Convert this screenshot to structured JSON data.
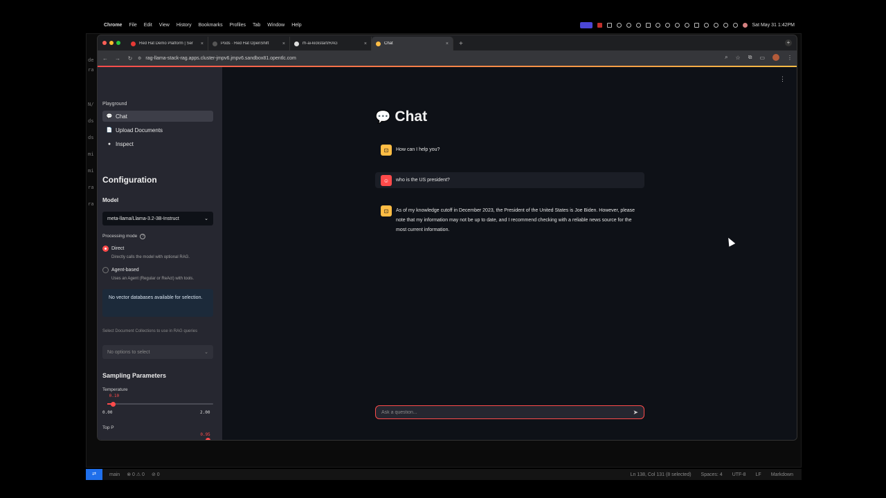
{
  "menubar": {
    "items": [
      "Chrome",
      "File",
      "Edit",
      "View",
      "History",
      "Bookmarks",
      "Profiles",
      "Tab",
      "Window",
      "Help"
    ],
    "clock": "Sat May 31  1:42PM"
  },
  "browser": {
    "tabs": [
      {
        "title": "Red Hat Demo Platform | Ser",
        "color": "#e53935"
      },
      {
        "title": "Pods · Red Hat OpenShift",
        "color": "#555555"
      },
      {
        "title": "rh-ai-kickstart/RAG",
        "color": "#dddddd"
      },
      {
        "title": "Chat",
        "color": "#ffbd45"
      }
    ],
    "url": "rag-llama-stack-rag.apps.cluster-jmpv6.jmpv6.sandbox81.opentlc.com"
  },
  "sidebar": {
    "section_label": "Playground",
    "nav": [
      {
        "label": "Chat",
        "icon": "💬"
      },
      {
        "label": "Upload Documents",
        "icon": "📄"
      },
      {
        "label": "Inspect",
        "icon": "●"
      }
    ],
    "config_title": "Configuration",
    "model_label": "Model",
    "model_value": "meta-llama/Llama-3.2-3B-Instruct",
    "processing_label": "Processing mode",
    "modes": [
      {
        "label": "Direct",
        "desc": "Directly calls the model with optional RAG.",
        "selected": true
      },
      {
        "label": "Agent-based",
        "desc": "Uses an Agent (Regular or ReAct) with tools.",
        "selected": false
      }
    ],
    "info": "No vector databases available for selection.",
    "collections_label": "Select Document Collections to use in RAG queries",
    "collections_placeholder": "No options to select",
    "sampling_title": "Sampling Parameters",
    "temperature": {
      "label": "Temperature",
      "value": 0.1,
      "value_text": "0.10",
      "min": "0.00",
      "max": "2.00"
    },
    "top_p": {
      "label": "Top P",
      "value": 0.95,
      "value_text": "0.95"
    }
  },
  "main": {
    "title": "Chat",
    "messages": [
      {
        "role": "assistant",
        "text": "How can I help you?"
      },
      {
        "role": "user",
        "text": "who is the US president?"
      },
      {
        "role": "assistant",
        "text": "As of my knowledge cutoff in December 2023, the President of the United States is Joe Biden. However, please note that my information may not be up to date, and I recommend checking with a reliable news source for the most current information."
      }
    ],
    "input_placeholder": "Ask a question..."
  },
  "statusbar": {
    "branch": "main",
    "problems": "⊗ 0 ⚠ 0",
    "ports": "⊘ 0",
    "position": "Ln 138, Col 131 (8 selected)",
    "spaces": "Spaces: 4",
    "encoding": "UTF-8",
    "eol": "LF",
    "language": "Markdown"
  },
  "colors": {
    "accent": "#ff4b4b",
    "bot_avatar": "#ffbd45",
    "sidebar_bg": "#262730",
    "page_bg": "#0e1117"
  }
}
